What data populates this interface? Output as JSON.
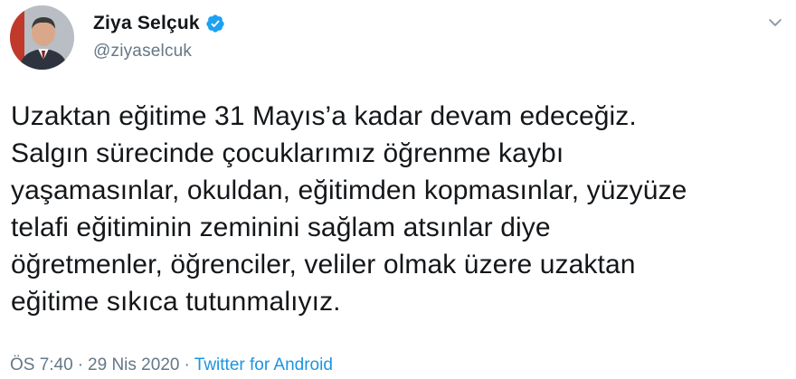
{
  "tweet": {
    "author": {
      "display_name": "Ziya Selçuk",
      "handle": "@ziyaselcuk",
      "verified": true,
      "verified_color": "#1da1f2",
      "avatar": "avatar-photo"
    },
    "body_lines": [
      "Uzaktan eğitime 31 Mayıs’a kadar devam edeceğiz.",
      "Salgın sürecinde çocuklarımız öğrenme kaybı",
      "yaşamasınlar, okuldan, eğitimden kopmasınlar, yüzyüze",
      "telafi eğitiminin zeminini sağlam atsınlar diye",
      "öğretmenler, öğrenciler, veliler olmak üzere uzaktan",
      "eğitime sıkıca tutunmalıyız."
    ],
    "meta": {
      "time": "ÖS 7:40",
      "separator": "·",
      "date": "29 Nis 2020",
      "source": "Twitter for Android"
    },
    "menu_icon": "chevron-down-icon",
    "colors": {
      "text": "#14171a",
      "secondary": "#657786",
      "link": "#1b95e0"
    }
  }
}
